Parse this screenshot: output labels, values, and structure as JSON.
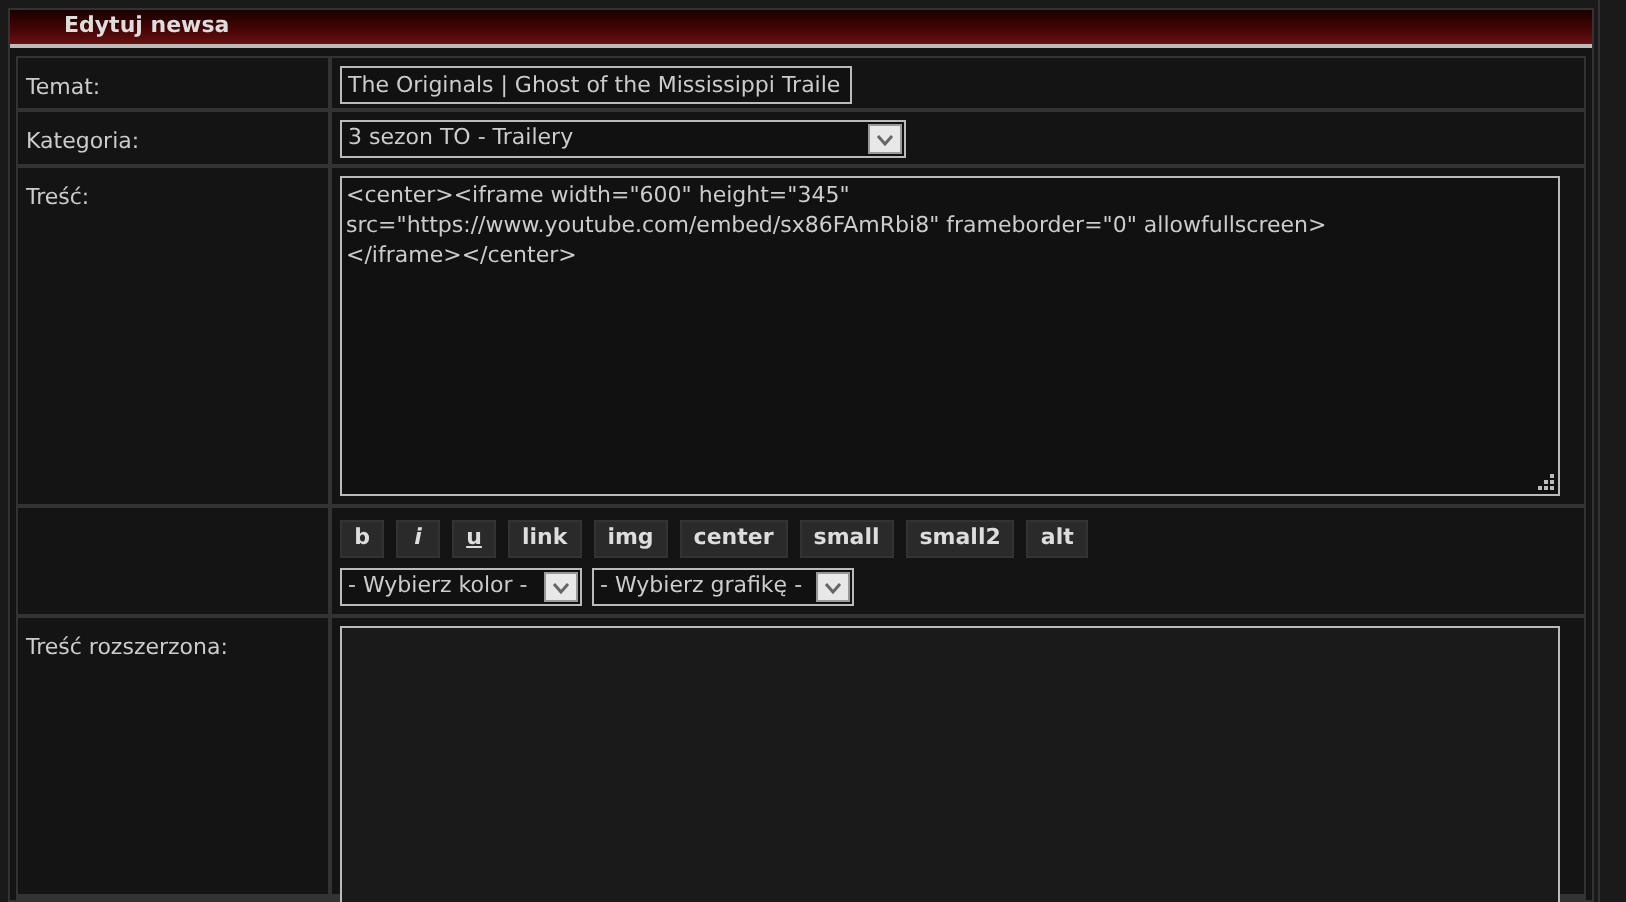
{
  "header": {
    "title": "Edytuj newsa"
  },
  "fields": [
    {
      "kind": "text",
      "label": "Temat:",
      "value": "The Originals | Ghost of the Mississippi Traile"
    },
    {
      "kind": "select",
      "label": "Kategoria:",
      "value": "3 sezon TO - Trailery"
    },
    {
      "kind": "textarea",
      "label": "Treść:",
      "value": "<center><iframe width=\"600\" height=\"345\" src=\"https://www.youtube.com/embed/sx86FAmRbi8\" frameborder=\"0\" allowfullscreen></iframe></center>"
    },
    {
      "kind": "toolbar",
      "buttons": [
        {
          "label": "b",
          "kind": "bold"
        },
        {
          "label": "i",
          "kind": "italic"
        },
        {
          "label": "u",
          "kind": "underline"
        },
        {
          "label": "link",
          "kind": "bold"
        },
        {
          "label": "img",
          "kind": "bold"
        },
        {
          "label": "center",
          "kind": "bold"
        },
        {
          "label": "small",
          "kind": "bold"
        },
        {
          "label": "small2",
          "kind": "bold"
        },
        {
          "label": "alt",
          "kind": "bold"
        }
      ],
      "selects": [
        "- Wybierz kolor -",
        "- Wybierz grafikę -"
      ]
    },
    {
      "kind": "textarea_tall",
      "label": "Treść rozszerzona:"
    }
  ]
}
